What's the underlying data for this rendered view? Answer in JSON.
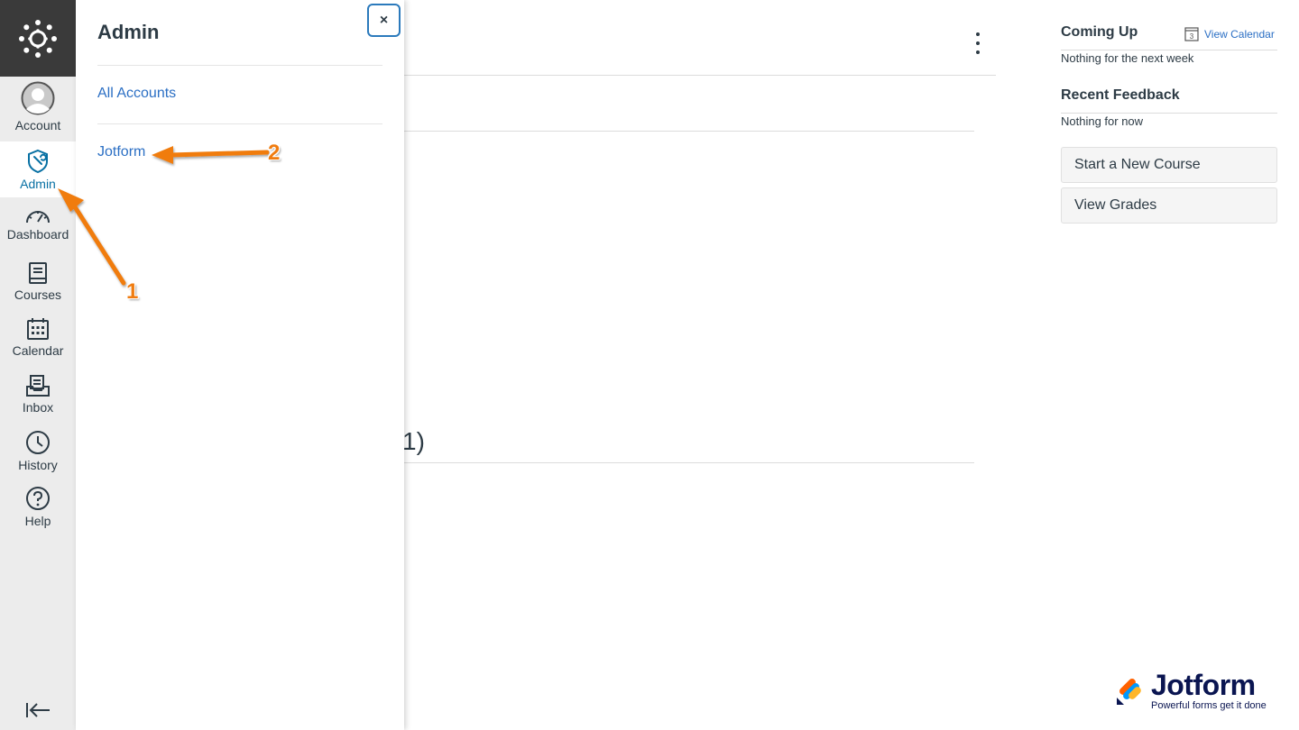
{
  "nav": {
    "items": [
      {
        "label": "Account",
        "icon": "avatar-icon"
      },
      {
        "label": "Admin",
        "icon": "shield-icon"
      },
      {
        "label": "Dashboard",
        "icon": "dashboard-icon"
      },
      {
        "label": "Courses",
        "icon": "book-icon"
      },
      {
        "label": "Calendar",
        "icon": "calendar-icon"
      },
      {
        "label": "Inbox",
        "icon": "inbox-icon"
      },
      {
        "label": "History",
        "icon": "clock-icon"
      },
      {
        "label": "Help",
        "icon": "help-icon"
      }
    ],
    "active": "Admin",
    "logo_icon": "canvas-logo-icon",
    "collapse_icon": "collapse-nav-icon"
  },
  "tray": {
    "title": "Admin",
    "close_label": "×",
    "links": [
      "All Accounts",
      "Jotform"
    ]
  },
  "main": {
    "partial_text": "1)"
  },
  "sidebar": {
    "coming_up_title": "Coming Up",
    "view_calendar": "View Calendar",
    "calendar_day": "3",
    "coming_up_empty": "Nothing for the next week",
    "feedback_title": "Recent Feedback",
    "feedback_empty": "Nothing for now",
    "buttons": [
      "Start a New Course",
      "View Grades"
    ]
  },
  "annotations": {
    "step1": "1",
    "step2": "2",
    "color": "#f07c10"
  },
  "watermark": {
    "name": "Jotform",
    "tagline": "Powerful forms get it done"
  },
  "colors": {
    "nav_bg": "#ececec",
    "logo_bg": "#3a3a3a",
    "link": "#2b6fc4",
    "active_nav": "#0770a3",
    "text": "#2d3b45"
  }
}
